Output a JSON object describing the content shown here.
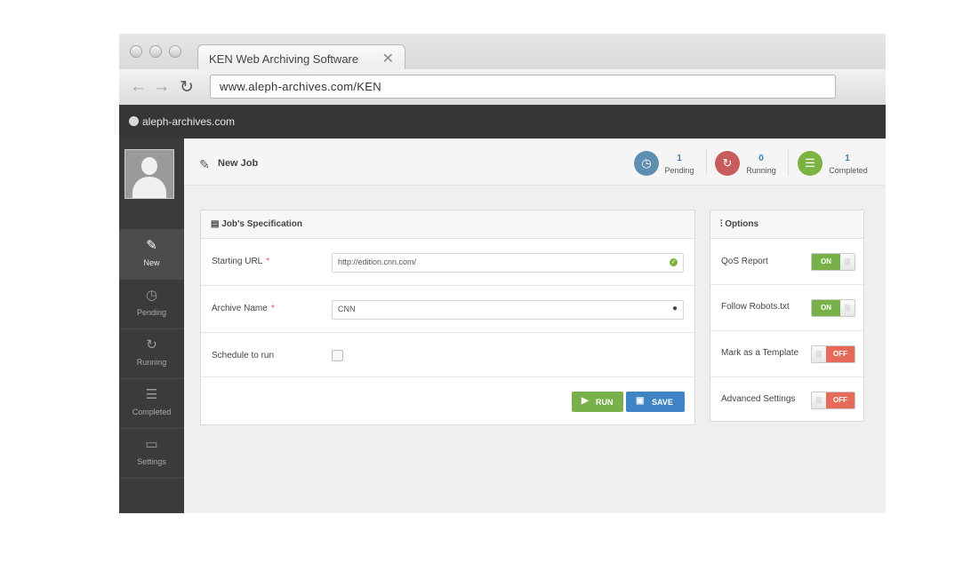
{
  "browser": {
    "tab_title": "KEN Web Archiving Software",
    "tab_close": "✕",
    "url": "www.aleph-archives.com/KEN"
  },
  "site": {
    "name": "aleph-archives.com"
  },
  "sidebar": {
    "items": [
      {
        "label": "New",
        "icon": "✎"
      },
      {
        "label": "Pending",
        "icon": "◷"
      },
      {
        "label": "Running",
        "icon": "↻"
      },
      {
        "label": "Completed",
        "icon": "☰"
      },
      {
        "label": "Settings",
        "icon": "▭"
      }
    ]
  },
  "header": {
    "title": "New Job",
    "stats": [
      {
        "value": "1",
        "label": "Pending",
        "icon": "◷",
        "color": "#5f8fb0"
      },
      {
        "value": "0",
        "label": "Running",
        "icon": "↻",
        "color": "#c75c5c"
      },
      {
        "value": "1",
        "label": "Completed",
        "icon": "☰",
        "color": "#7cb342"
      }
    ]
  },
  "job_spec": {
    "title": "Job's Specification",
    "fields": {
      "starting_url": {
        "label": "Starting URL",
        "required": "*",
        "value": "http://edition.cnn.com/"
      },
      "archive_name": {
        "label": "Archive Name",
        "required": "*",
        "value": "CNN"
      },
      "schedule": {
        "label": "Schedule to run"
      }
    },
    "buttons": {
      "run": "RUN",
      "save": "SAVE"
    }
  },
  "options": {
    "title": "Options",
    "items": [
      {
        "label": "QoS Report",
        "state": "ON"
      },
      {
        "label": "Follow Robots.txt",
        "state": "ON"
      },
      {
        "label": "Mark as a Template",
        "state": "OFF"
      },
      {
        "label": "Advanced Settings",
        "state": "OFF"
      }
    ]
  },
  "colors": {
    "accent_green": "#78b04a",
    "accent_blue": "#3f7fb5",
    "off_red": "#e56a57",
    "sidebar": "#3b3b3b"
  }
}
